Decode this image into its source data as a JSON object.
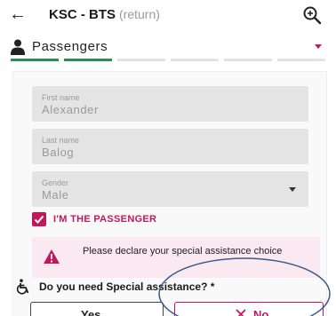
{
  "header": {
    "route": "KSC - BTS",
    "route_sub": "(return)"
  },
  "steps": {
    "title": "Passengers",
    "segments": [
      true,
      true,
      false,
      false,
      false,
      false
    ]
  },
  "form": {
    "first_name": {
      "label": "First name",
      "value": "Alexander"
    },
    "last_name": {
      "label": "Last name",
      "value": "Balog"
    },
    "gender": {
      "label": "Gender",
      "value": "Male"
    },
    "passenger_checkbox": {
      "label": "I'M THE PASSENGER",
      "checked": true
    },
    "alert_text": "Please declare your special assistance choice",
    "question": "Do you need Special assistance? *",
    "yes_label": "Yes",
    "no_label": "No"
  },
  "colors": {
    "accent": "#c2185b",
    "progress_done": "#2e8b57",
    "annotation": "#3a5a8c"
  },
  "icons": [
    "back-arrow-icon",
    "zoom-in-icon",
    "user-icon",
    "chevron-down-icon",
    "check-icon",
    "warning-icon",
    "wheelchair-icon",
    "x-icon"
  ]
}
